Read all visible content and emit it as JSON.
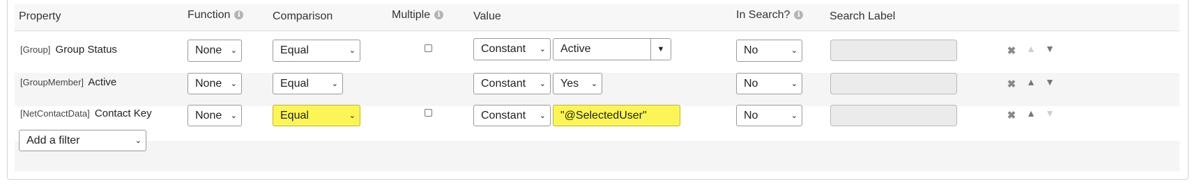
{
  "headers": {
    "property": "Property",
    "function": "Function",
    "comparison": "Comparison",
    "multiple": "Multiple",
    "value": "Value",
    "in_search": "In Search?",
    "search_label": "Search Label",
    "info_glyph": "i"
  },
  "rows": [
    {
      "entity": "[Group]",
      "name": "Group Status",
      "function": "None",
      "comparison": "Equal",
      "value_type": "Constant",
      "value": "Active",
      "in_search": "No"
    },
    {
      "entity": "[GroupMember]",
      "name": "Active",
      "function": "None",
      "comparison": "Equal",
      "value_type": "Constant",
      "value": "Yes",
      "in_search": "No"
    },
    {
      "entity": "[NetContactData]",
      "name": "Contact Key",
      "function": "None",
      "comparison": "Equal",
      "value_type": "Constant",
      "value": "\"@SelectedUser\"",
      "in_search": "No"
    }
  ],
  "add_filter": "Add a filter",
  "icons": {
    "remove": "✖",
    "up": "▲",
    "down": "▼",
    "dropdown": "⌄"
  },
  "colors": {
    "highlight": "#fbf557"
  }
}
